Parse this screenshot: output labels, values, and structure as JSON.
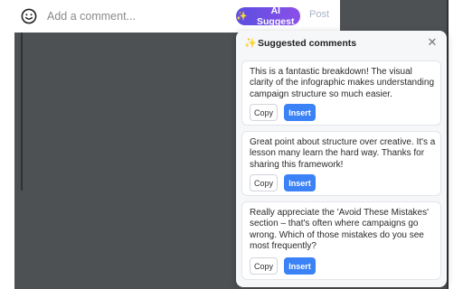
{
  "comment_bar": {
    "placeholder": "Add a comment...",
    "emoji_icon": "smiley-face-icon",
    "ai_suggest_label": "AI Suggest",
    "post_label": "Post"
  },
  "panel": {
    "title": "Suggested comments",
    "close_icon": "close-icon",
    "sparkle_icon": "sparkle-icon",
    "suggestions": [
      {
        "text": "This is a fantastic breakdown! The visual clarity of the infographic makes understanding campaign structure so much easier.",
        "copy_label": "Copy",
        "insert_label": "Insert"
      },
      {
        "text": "Great point about structure over creative. It's a lesson many learn the hard way. Thanks for sharing this framework!",
        "copy_label": "Copy",
        "insert_label": "Insert"
      },
      {
        "text": "Really appreciate the 'Avoid These Mistakes' section – that's often where campaigns go wrong. Which of those mistakes do you see most frequently?",
        "copy_label": "Copy",
        "insert_label": "Insert"
      }
    ]
  },
  "colors": {
    "ai_gradient_start": "#5b4fe0",
    "ai_gradient_end": "#8b4fe8",
    "insert_blue": "#3b82f6",
    "post_muted": "#a9b4c8",
    "backdrop_dark": "#4e5154"
  }
}
